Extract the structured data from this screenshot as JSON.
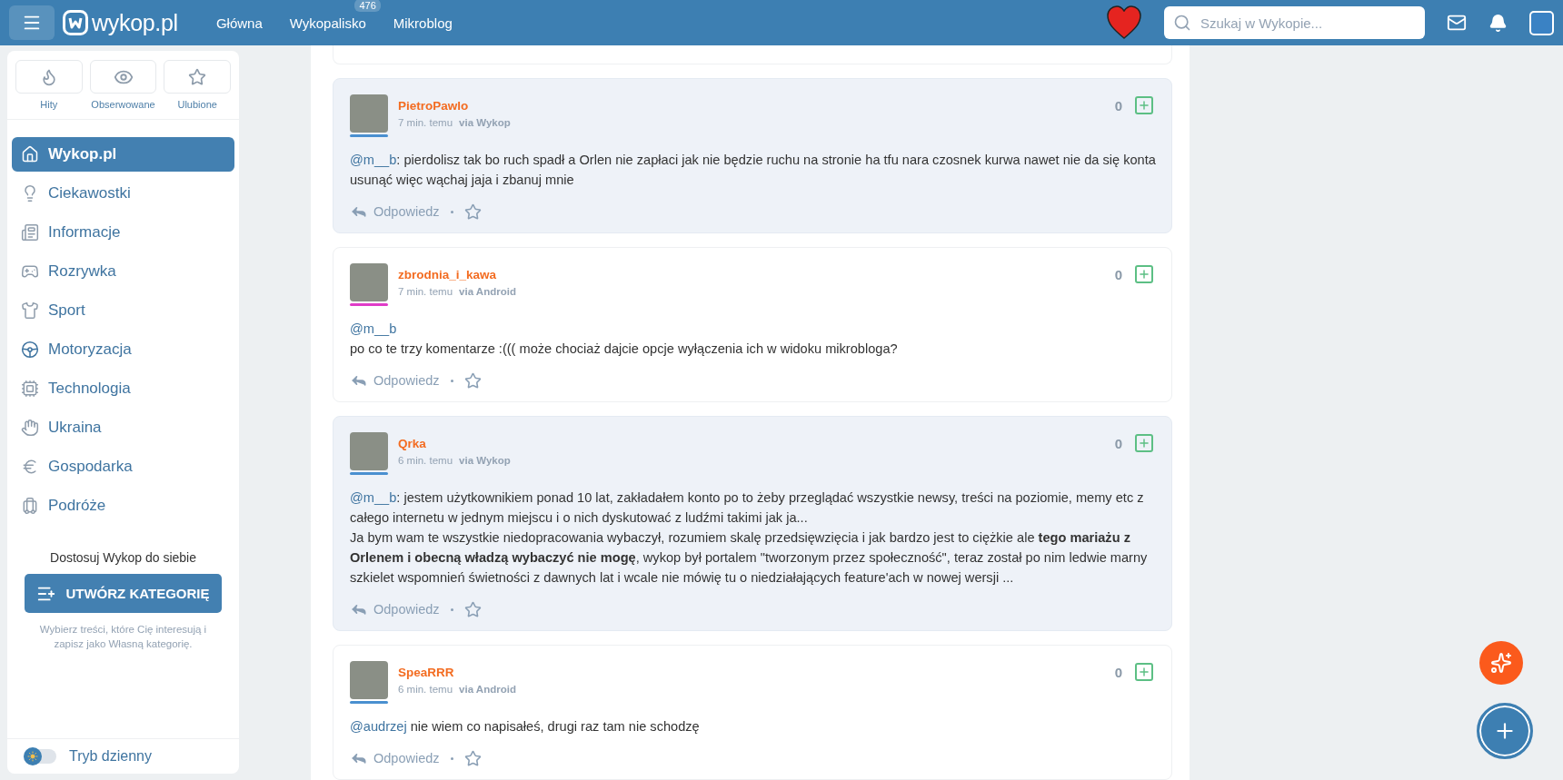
{
  "header": {
    "logo": "wykop.pl",
    "nav": [
      {
        "label": "Główna"
      },
      {
        "label": "Wykopalisko",
        "badge": "476"
      },
      {
        "label": "Mikroblog"
      }
    ],
    "search": {
      "placeholder": "Szukaj w Wykopie..."
    }
  },
  "sidebar": {
    "quick": [
      {
        "label": "Hity"
      },
      {
        "label": "Obserwowane"
      },
      {
        "label": "Ulubione"
      }
    ],
    "menu": [
      {
        "label": "Wykop.pl",
        "selected": true
      },
      {
        "label": "Ciekawostki",
        "selected": false
      },
      {
        "label": "Informacje",
        "selected": false
      },
      {
        "label": "Rozrywka",
        "selected": false
      },
      {
        "label": "Sport",
        "selected": false
      },
      {
        "label": "Motoryzacja",
        "selected": false
      },
      {
        "label": "Technologia",
        "selected": false
      },
      {
        "label": "Ukraina",
        "selected": false
      },
      {
        "label": "Gospodarka",
        "selected": false
      },
      {
        "label": "Podróże",
        "selected": false
      }
    ],
    "customize": {
      "title": "Dostosuj Wykop do siebie",
      "button": "UTWÓRZ KATEGORIĘ",
      "hint": "Wybierz treści, które Cię interesują i zapisz jako Własną kategorię."
    },
    "theme_toggle": {
      "label": "Tryb dzienny",
      "on": false
    }
  },
  "comments": [
    {
      "author": "PietroPawlo",
      "time": "7 min. temu",
      "via": "via Wykop",
      "votes": "0",
      "highlighted": true,
      "color": "#4a90d0",
      "reply": "Odpowiedz",
      "lines": [
        {
          "mention": "@m__b",
          "text": ": pierdolisz tak bo ruch spadł a Orlen nie zapłaci jak nie będzie ruchu na stronie ha tfu nara czosnek kurwa nawet nie da się konta usunąć więc wąchaj jaja i zbanuj mnie"
        }
      ]
    },
    {
      "author": "zbrodnia_i_kawa",
      "time": "7 min. temu",
      "via": "via Android",
      "votes": "0",
      "highlighted": false,
      "color": "#e03cc8",
      "reply": "Odpowiedz",
      "lines": [
        {
          "mention": "@m__b"
        },
        {
          "text": "po co te trzy komentarze :((( może chociaż dajcie opcje wyłączenia ich w widoku mikrobloga?"
        }
      ]
    },
    {
      "author": "Qrka",
      "time": "6 min. temu",
      "via": "via Wykop",
      "votes": "0",
      "highlighted": true,
      "color": "#4a90d0",
      "reply": "Odpowiedz",
      "lines": [
        {
          "mention": "@m__b",
          "text": ": jestem użytkownikiem ponad 10 lat, zakładałem konto po to żeby przeglądać wszystkie newsy, treści na poziomie, memy etc z całego internetu w jednym miejscu i o nich dyskutować z ludźmi takimi jak ja..."
        },
        {
          "text": "Ja bym wam te wszystkie niedopracowania wybaczył, rozumiem skalę przedsięwzięcia i jak bardzo jest to ciężkie ale **tego mariażu z Orlenem i obecną władzą wybaczyć nie mogę**, wykop był portalem \"tworzonym przez społeczność\", teraz został po nim ledwie marny szkielet wspomnień świetności z dawnych lat i wcale nie mówię tu o niedziałających feature'ach w nowej wersji ..."
        }
      ]
    },
    {
      "author": "SpeaRRR",
      "time": "6 min. temu",
      "via": "via Android",
      "votes": "0",
      "highlighted": false,
      "color": "#4a90d0",
      "reply": "Odpowiedz",
      "lines": [
        {
          "mention": "@audrzej",
          "text": " nie wiem co napisałeś, drugi raz tam nie schodzę"
        }
      ]
    }
  ]
}
